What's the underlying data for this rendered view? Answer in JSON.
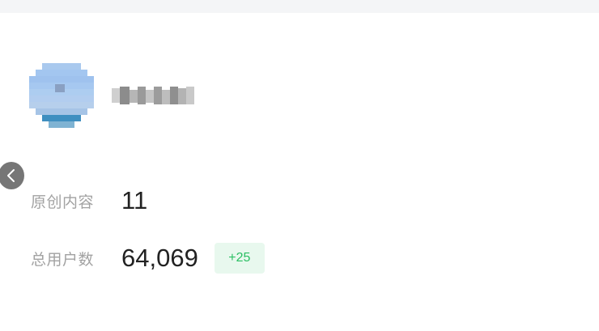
{
  "account": {
    "avatar_icon": "user-avatar-pixelated",
    "name_redacted": true
  },
  "nav": {
    "back_icon": "chevron-left-icon"
  },
  "stats": [
    {
      "label": "原创内容",
      "value": "11"
    },
    {
      "label": "总用户数",
      "value": "64,069",
      "delta": "+25"
    }
  ],
  "colors": {
    "label": "#a2a2a2",
    "value": "#222222",
    "badge_text": "#2bbf63",
    "badge_bg": "#e8f8ee",
    "back_button_bg": "#767676"
  }
}
